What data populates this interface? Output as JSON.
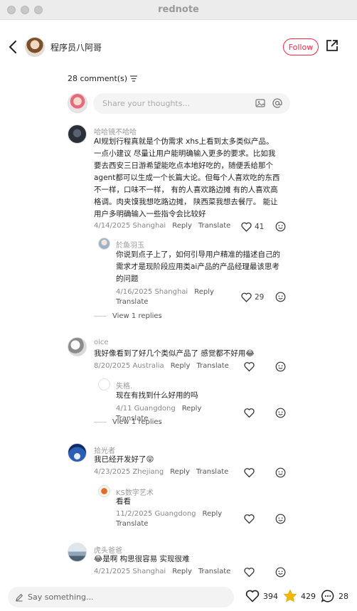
{
  "window": {
    "title": "rednote"
  },
  "header": {
    "author_name": "程序员八阿哥",
    "follow_label": "Follow"
  },
  "comments_header": {
    "count_label": "28 comment(s)"
  },
  "compose": {
    "placeholder": "Share your thoughts..."
  },
  "comments": [
    {
      "user": "哈哈镜不哈哈",
      "lines": [
        "AI规划行程真就是个伪需求 xhs上看到太多类似产品。",
        "一点小建议 尽量让用户能明确输入更多的要求。比如我",
        "要去西安三日游希望能吃点本地好吃的，随便丢给那个",
        "agent都可以生成一个长篇大论。但每个人喜欢吃的东西",
        "不一样，口味不一样，  有的人喜欢路边摊 有的人喜欢高",
        "格调。肉夹馍我想吃路边摊，  陕西菜我想去餐厅。  能让",
        "用户多明确输入一些指令会比较好"
      ],
      "date": "4/14/2025 Shanghai",
      "reply": "Reply",
      "translate": "Translate",
      "likes": "41",
      "replies": [
        {
          "user": "於鱼羽玉",
          "lines": [
            "你说到点子上了，如何引导用户精准的描述自己的",
            "需求才是现阶段应用类ai产品的产品经理最该思考",
            "的问题"
          ],
          "date": "4/16/2025 Shanghai",
          "reply": "Reply",
          "translate": "Translate",
          "likes": "29"
        }
      ],
      "view_replies": "View 1 replies"
    },
    {
      "user": "oice",
      "lines": [
        "我好像看到了好几个类似产品了 感觉都不好用😂"
      ],
      "date": "8/20/2025 Australia",
      "reply": "Reply",
      "translate": "Translate",
      "replies": [
        {
          "user": "失格.",
          "lines": [
            "现在有找到什么好用的吗"
          ],
          "date": "4/11 Guangdong",
          "reply": "Reply",
          "translate": "Translate"
        }
      ],
      "view_replies": "View 1 replies"
    },
    {
      "user": "拾光者",
      "lines": [
        "我已经开发好了😝"
      ],
      "date": "4/23/2025 Zhejiang",
      "reply": "Reply",
      "translate": "Translate",
      "replies": [
        {
          "user": "KS数字艺术",
          "lines": [
            "看看"
          ],
          "date": "11/2/2025 Guangdong",
          "reply": "Reply",
          "translate": "Translate"
        }
      ]
    },
    {
      "user": "虎头爸爸",
      "lines": [
        "😂是啊 构思很容易 实现很难"
      ],
      "date": "4/21/2025 Shanghai",
      "reply": "Reply",
      "translate": "Translate"
    }
  ],
  "bottom": {
    "say_placeholder": "Say something...",
    "likes": "394",
    "collects": "429",
    "comments": "28"
  },
  "colors": {
    "accent": "#ff2442",
    "collect_star": "#f5b800"
  },
  "icons": [
    "back-icon",
    "share-icon",
    "sort-icon",
    "image-icon",
    "mention-icon",
    "heart-icon",
    "reply-icon",
    "pencil-icon",
    "star-icon",
    "comment-icon"
  ]
}
